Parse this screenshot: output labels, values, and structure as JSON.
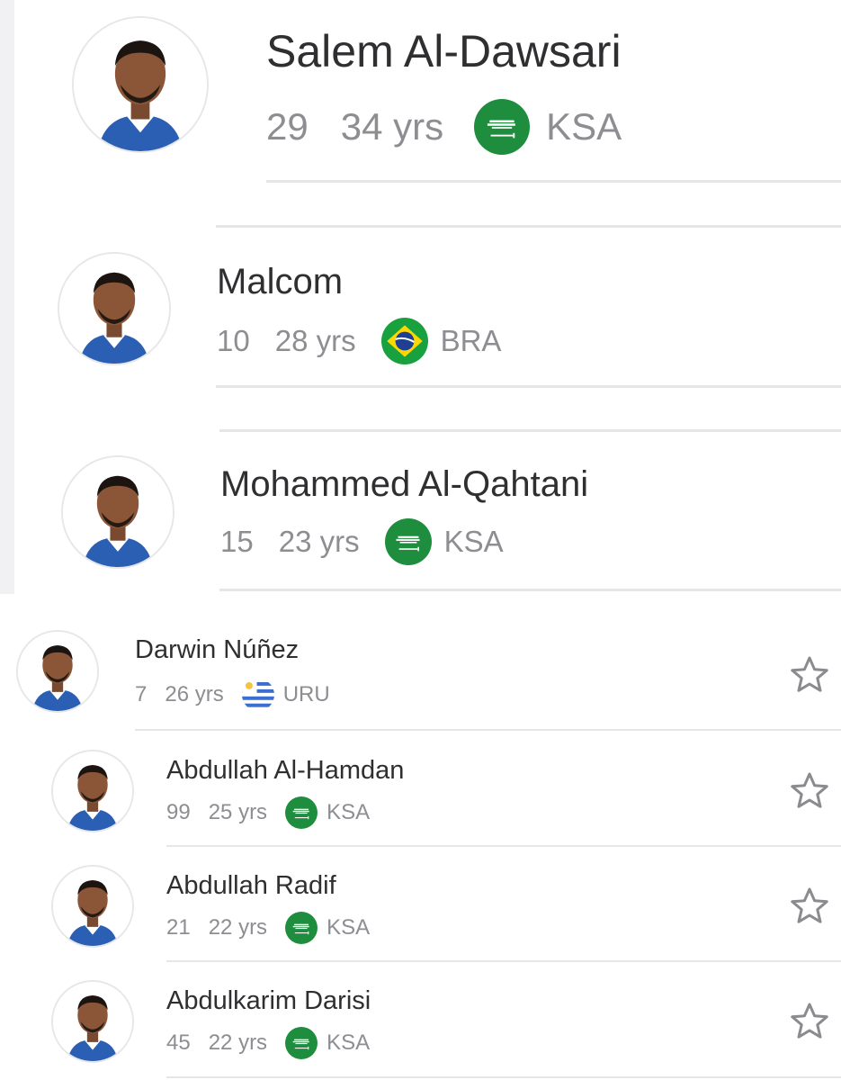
{
  "colors": {
    "ksa_green": "#1e8e3e",
    "text": "#2f2f31",
    "meta": "#8d8d92",
    "divider": "#e6e6e8"
  },
  "players": [
    {
      "name": "Salem Al-Dawsari",
      "number": "29",
      "age": "34 yrs",
      "country": "KSA",
      "flag": "saudi-flag-icon",
      "favorite": false
    },
    {
      "name": "Malcom",
      "number": "10",
      "age": "28 yrs",
      "country": "BRA",
      "flag": "brazil-flag-icon",
      "favorite": false
    },
    {
      "name": "Mohammed Al-Qahtani",
      "number": "15",
      "age": "23 yrs",
      "country": "KSA",
      "flag": "saudi-flag-icon",
      "favorite": false
    },
    {
      "name": "Darwin Núñez",
      "number": "7",
      "age": "26 yrs",
      "country": "URU",
      "flag": "uruguay-flag-icon",
      "favorite": false
    },
    {
      "name": "Abdullah Al-Hamdan",
      "number": "99",
      "age": "25 yrs",
      "country": "KSA",
      "flag": "saudi-flag-icon",
      "favorite": false
    },
    {
      "name": "Abdullah Radif",
      "number": "21",
      "age": "22 yrs",
      "country": "KSA",
      "flag": "saudi-flag-icon",
      "favorite": false
    },
    {
      "name": "Abdulkarim Darisi",
      "number": "45",
      "age": "22 yrs",
      "country": "KSA",
      "flag": "saudi-flag-icon",
      "favorite": false
    }
  ]
}
